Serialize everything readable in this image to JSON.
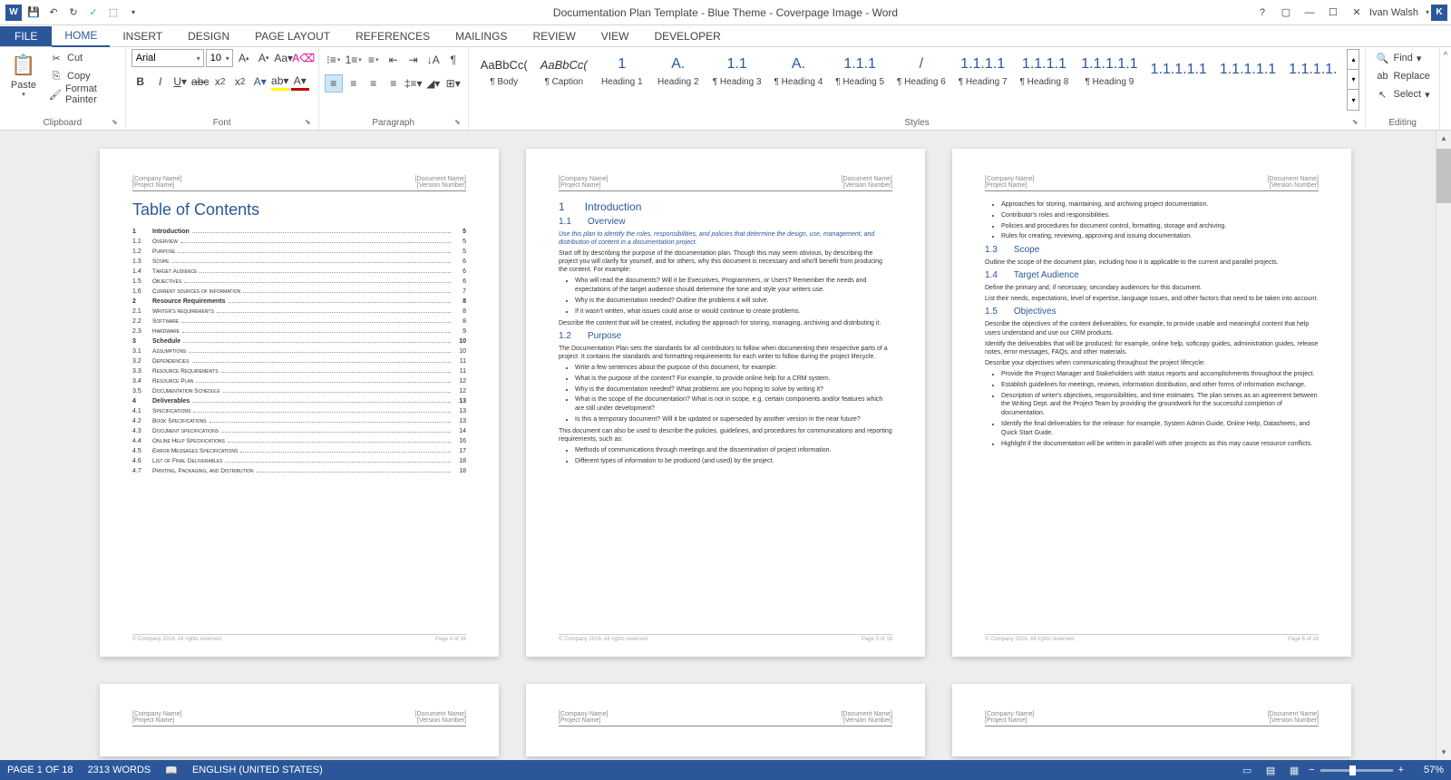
{
  "app": {
    "title": "Documentation Plan Template - Blue Theme - Coverpage Image - Word",
    "user": "Ivan Walsh",
    "userInitial": "K"
  },
  "tabs": [
    "FILE",
    "HOME",
    "INSERT",
    "DESIGN",
    "PAGE LAYOUT",
    "REFERENCES",
    "MAILINGS",
    "REVIEW",
    "VIEW",
    "DEVELOPER"
  ],
  "ribbon": {
    "clipboard": {
      "label": "Clipboard",
      "paste": "Paste",
      "cut": "Cut",
      "copy": "Copy",
      "format": "Format Painter"
    },
    "font": {
      "label": "Font",
      "family": "Arial",
      "size": "10"
    },
    "paragraph": {
      "label": "Paragraph"
    },
    "styles": {
      "label": "Styles",
      "items": [
        {
          "preview": "AaBbCc(",
          "name": "¶ Body",
          "cls": "body"
        },
        {
          "preview": "AaBbCc(",
          "name": "¶ Caption",
          "cls": "caption"
        },
        {
          "preview": "1",
          "name": "Heading 1",
          "cls": ""
        },
        {
          "preview": "A.",
          "name": "Heading 2",
          "cls": ""
        },
        {
          "preview": "1.1",
          "name": "¶ Heading 3",
          "cls": ""
        },
        {
          "preview": "A.",
          "name": "¶ Heading 4",
          "cls": ""
        },
        {
          "preview": "1.1.1",
          "name": "¶ Heading 5",
          "cls": ""
        },
        {
          "preview": "/",
          "name": "¶ Heading 6",
          "cls": ""
        },
        {
          "preview": "1.1.1.1",
          "name": "¶ Heading 7",
          "cls": ""
        },
        {
          "preview": "1.1.1.1",
          "name": "¶ Heading 8",
          "cls": ""
        },
        {
          "preview": "1.1.1.1.1",
          "name": "¶ Heading 9",
          "cls": ""
        },
        {
          "preview": "1.1.1.1.1",
          "name": "",
          "cls": ""
        },
        {
          "preview": "1.1.1.1.1",
          "name": "",
          "cls": ""
        },
        {
          "preview": "1.1.1.1.",
          "name": "",
          "cls": ""
        }
      ]
    },
    "editing": {
      "label": "Editing",
      "find": "Find",
      "replace": "Replace",
      "select": "Select"
    }
  },
  "document": {
    "header": {
      "left1": "[Company Name]",
      "left2": "[Project Name]",
      "right1": "[Document Name]",
      "right2": "[Version Number]"
    },
    "footer": {
      "left": "© Company 2016. All rights reserved.",
      "p4": "Page 4 of 18",
      "p5": "Page 5 of 18",
      "p6": "Page 6 of 18"
    },
    "tocTitle": "Table of Contents",
    "toc": [
      {
        "l": 1,
        "n": "1",
        "t": "Introduction",
        "p": "5"
      },
      {
        "l": 2,
        "n": "1.1",
        "t": "Overview",
        "p": "5"
      },
      {
        "l": 2,
        "n": "1.2",
        "t": "Purpose",
        "p": "5"
      },
      {
        "l": 2,
        "n": "1.3",
        "t": "Scope",
        "p": "6"
      },
      {
        "l": 2,
        "n": "1.4",
        "t": "Target Audience",
        "p": "6"
      },
      {
        "l": 2,
        "n": "1.5",
        "t": "Objectives",
        "p": "6"
      },
      {
        "l": 2,
        "n": "1.6",
        "t": "Current sources of information",
        "p": "7"
      },
      {
        "l": 1,
        "n": "2",
        "t": "Resource Requirements",
        "p": "8"
      },
      {
        "l": 2,
        "n": "2.1",
        "t": "Writer's requirements",
        "p": "8"
      },
      {
        "l": 2,
        "n": "2.2",
        "t": "Software",
        "p": "8"
      },
      {
        "l": 2,
        "n": "2.3",
        "t": "Hardware",
        "p": "9"
      },
      {
        "l": 1,
        "n": "3",
        "t": "Schedule",
        "p": "10"
      },
      {
        "l": 2,
        "n": "3.1",
        "t": "Assumptions",
        "p": "10"
      },
      {
        "l": 2,
        "n": "3.2",
        "t": "Dependencies",
        "p": "11"
      },
      {
        "l": 2,
        "n": "3.3",
        "t": "Resource Requirements",
        "p": "11"
      },
      {
        "l": 2,
        "n": "3.4",
        "t": "Resource Plan",
        "p": "12"
      },
      {
        "l": 2,
        "n": "3.5",
        "t": "Documentation Schedule",
        "p": "12"
      },
      {
        "l": 1,
        "n": "4",
        "t": "Deliverables",
        "p": "13"
      },
      {
        "l": 2,
        "n": "4.1",
        "t": "Specifications",
        "p": "13"
      },
      {
        "l": 2,
        "n": "4.2",
        "t": "Book Specifications",
        "p": "13"
      },
      {
        "l": 2,
        "n": "4.3",
        "t": "Document specifications",
        "p": "14"
      },
      {
        "l": 2,
        "n": "4.4",
        "t": "Online Help Specifications",
        "p": "16"
      },
      {
        "l": 2,
        "n": "4.5",
        "t": "Error Messages Specifications",
        "p": "17"
      },
      {
        "l": 2,
        "n": "4.6",
        "t": "List of Final Deliverables",
        "p": "18"
      },
      {
        "l": 2,
        "n": "4.7",
        "t": "Printing, Packaging, and Distribution",
        "p": "18"
      }
    ],
    "p2": {
      "h1n": "1",
      "h1": "Introduction",
      "s1n": "1.1",
      "s1": "Overview",
      "em": "Use this plan to identify the roles, responsibilities, and policies that determine the design, use, management, and distribution of content in a documentation project.",
      "p1": "Start off by describing the purpose of the documentation plan. Though this may seem obvious, by describing the project you will clarify for yourself, and for others, why this document is necessary and who'll benefit from producing the content. For example:",
      "b1": [
        "Who will read the documents? Will it be Executives, Programmers, or Users? Remember the needs and expectations of the target audience should determine the tone and style your writers use.",
        "Why is the documentation needed? Outline the problems it will solve.",
        "If it wasn't written, what issues could arise or would continue to create problems."
      ],
      "p2": "Describe the content that will be created, including the approach for storing, managing, archiving and distributing it.",
      "s2n": "1.2",
      "s2": "Purpose",
      "p3": "The Documentation Plan sets the standards for all contributors to follow when documenting their respective parts of a project. It contains the standards and formatting requirements for each writer to follow during the project lifecycle.",
      "b2": [
        "Write a few sentences about the purpose of this document, for example:",
        "What is the purpose of the content? For example, to provide online help for a CRM system.",
        "Why is the documentation needed? What problems are you hoping to solve by writing it?",
        "What is the scope of the documentation? What is not in scope, e.g. certain components and/or features which are still under development?",
        "Is this a temporary document? Will it be updated or superseded by another version in the near future?"
      ],
      "p4": "This document can also be used to describe the policies, guidelines, and procedures for communications and reporting requirements, such as:",
      "b3": [
        "Methods of communications through meetings and the dissemination of project information.",
        "Different types of information to be produced (and used) by the project."
      ]
    },
    "p3": {
      "b0": [
        "Approaches for storing, maintaining, and archiving project documentation.",
        "Contributor's roles and responsibilities.",
        "Policies and procedures for document control, formatting, storage and archiving.",
        "Rules for creating, reviewing, approving and issuing documentation."
      ],
      "s3n": "1.3",
      "s3": "Scope",
      "p5": "Outline the scope of the document plan, including how it is applicable to the current and parallel projects.",
      "s4n": "1.4",
      "s4": "Target Audience",
      "p6": "Define the primary and, if necessary, secondary audiences for this document.",
      "p7": "List their needs, expectations, level of expertise, language issues, and other factors that need to be taken into account.",
      "s5n": "1.5",
      "s5": "Objectives",
      "p8": "Describe the objectives of the content deliverables, for example, to provide usable and meaningful content that help users understand and use our CRM products.",
      "p9": "Identify the deliverables that will be produced: for example, online help, softcopy guides, administration guides, release notes, error messages, FAQs, and other materials.",
      "p10": "Describe your objectives when communicating throughout the project lifecycle:",
      "b4": [
        "Provide the Project Manager and Stakeholders with status reports and accomplishments throughout the project.",
        "Establish guidelines for meetings, reviews, information distribution, and other forms of information exchange.",
        "Description of writer's objectives, responsibilities, and time estimates. The plan serves as an agreement between the Writing Dept. and the Project Team by providing the groundwork for the successful completion of documentation.",
        "Identify the final deliverables for the release: for example, System Admin Guide, Online Help, Datasheets, and Quick Start Guide.",
        "Highlight if the documentation will be written in parallel with other projects as this may cause resource conflicts."
      ]
    }
  },
  "status": {
    "page": "PAGE 1 OF 18",
    "words": "2313 WORDS",
    "lang": "ENGLISH (UNITED STATES)",
    "zoom": "57%"
  }
}
